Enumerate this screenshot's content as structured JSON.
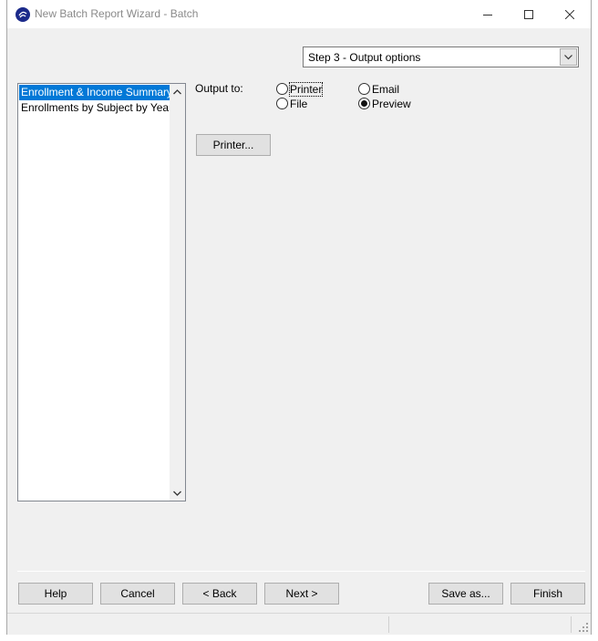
{
  "window": {
    "title": "New Batch Report Wizard - Batch",
    "icon": "wizard-app-icon"
  },
  "step_select": {
    "value": "Step 3 - Output options"
  },
  "reports_list": {
    "items": [
      {
        "label": "Enrollment & Income Summary",
        "selected": true
      },
      {
        "label": "Enrollments by Subject by Year",
        "selected": false
      }
    ]
  },
  "output": {
    "label": "Output to:",
    "options": {
      "printer": {
        "label": "Printer",
        "checked": false
      },
      "file": {
        "label": "File",
        "checked": false
      },
      "email": {
        "label": "Email",
        "checked": false
      },
      "preview": {
        "label": "Preview",
        "checked": true
      }
    },
    "printer_button": "Printer..."
  },
  "footer": {
    "help": "Help",
    "cancel": "Cancel",
    "back": "< Back",
    "next": "Next >",
    "save_as": "Save as...",
    "finish": "Finish"
  },
  "colors": {
    "selection": "#0078d7",
    "button_face": "#e1e1e1",
    "window_bg": "#f0f0f0"
  }
}
